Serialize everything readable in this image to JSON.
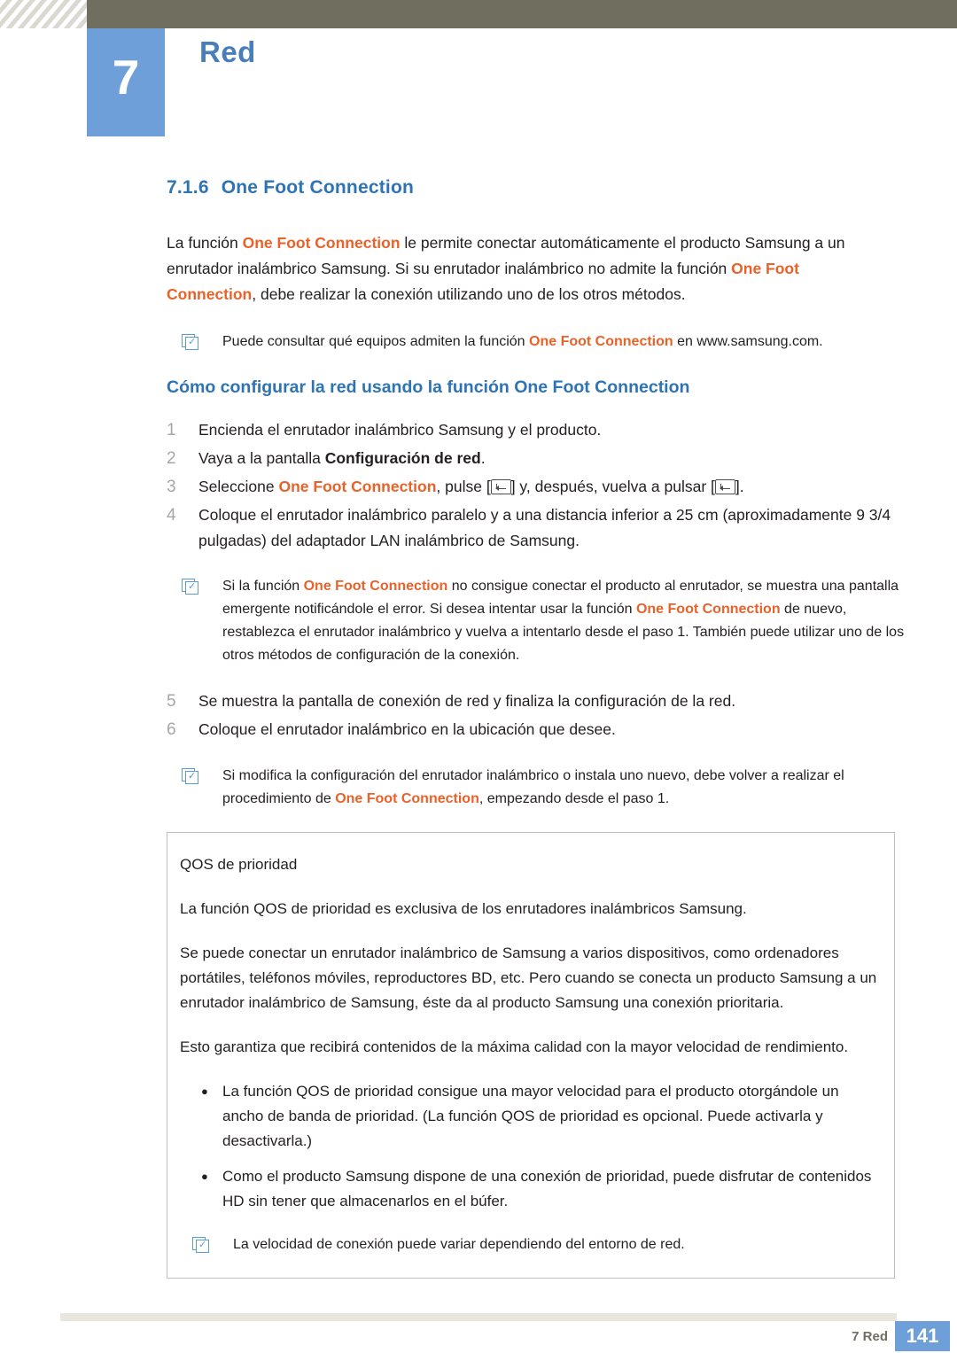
{
  "header": {
    "chapter_number": "7",
    "chapter_title": "Red"
  },
  "section": {
    "number": "7.1.6",
    "title": "One Foot Connection"
  },
  "intro": {
    "p1_a": "La función ",
    "p1_b": "One Foot Connection",
    "p1_c": " le permite conectar automáticamente el producto Samsung a un enrutador inalámbrico Samsung. Si su enrutador inalámbrico no admite la función ",
    "p1_d": "One Foot Connection",
    "p1_e": ", debe realizar la conexión utilizando uno de los otros métodos."
  },
  "note1": {
    "a": "Puede consultar qué equipos admiten la función ",
    "b": "One Foot Connection",
    "c": " en www.samsung.com."
  },
  "subheading": "Cómo configurar la red usando la función One Foot Connection",
  "steps": [
    {
      "n": "1",
      "text": "Encienda el enrutador inalámbrico Samsung y el producto."
    },
    {
      "n": "2",
      "a": "Vaya a la pantalla ",
      "b": "Configuración de red",
      "c": "."
    },
    {
      "n": "3",
      "a": "Seleccione ",
      "b": "One Foot Connection",
      "c": ", pulse [",
      "d": "] y, después, vuelva a pulsar [",
      "e": "]."
    },
    {
      "n": "4",
      "text": "Coloque el enrutador inalámbrico paralelo y a una distancia inferior a 25 cm (aproximadamente 9 3/4 pulgadas) del adaptador LAN inalámbrico de Samsung."
    },
    {
      "n": "5",
      "text": "Se muestra la pantalla de conexión de red y finaliza la configuración de la red."
    },
    {
      "n": "6",
      "text": "Coloque el enrutador inalámbrico en la ubicación que desee."
    }
  ],
  "note2": {
    "a": "Si la función ",
    "b": "One Foot Connection",
    "c": " no consigue conectar el producto al enrutador, se muestra una pantalla emergente notificándole el error. Si desea intentar usar la función ",
    "d": "One Foot Connection",
    "e": " de nuevo, restablezca el enrutador inalámbrico y vuelva a intentarlo desde el paso 1. También puede utilizar uno de los otros métodos de configuración de la conexión."
  },
  "note3": {
    "a": "Si modifica la configuración del enrutador inalámbrico o instala uno nuevo, debe volver a realizar el procedimiento de ",
    "b": "One Foot Connection",
    "c": ", empezando desde el paso 1."
  },
  "qos": {
    "title": "QOS de prioridad",
    "p1": "La función QOS de prioridad es exclusiva de los enrutadores inalámbricos Samsung.",
    "p2": "Se puede conectar un enrutador inalámbrico de Samsung a varios dispositivos, como ordenadores portátiles, teléfonos móviles, reproductores BD, etc. Pero cuando se conecta un producto Samsung a un enrutador inalámbrico de Samsung, éste da al producto Samsung una conexión prioritaria.",
    "p3": "Esto garantiza que recibirá contenidos de la máxima calidad con la mayor velocidad de rendimiento.",
    "bullets": [
      "La función QOS de prioridad consigue una mayor velocidad para el producto otorgándole un ancho de banda de prioridad. (La función QOS de prioridad es opcional. Puede activarla y desactivarla.)",
      "Como el producto Samsung dispone de una conexión de prioridad, puede disfrutar de contenidos HD sin tener que almacenarlos en el búfer."
    ],
    "bullet_char": "●",
    "note": "La velocidad de conexión puede variar dependiendo del entorno de red."
  },
  "footer": {
    "label": "7 Red",
    "page": "141"
  }
}
